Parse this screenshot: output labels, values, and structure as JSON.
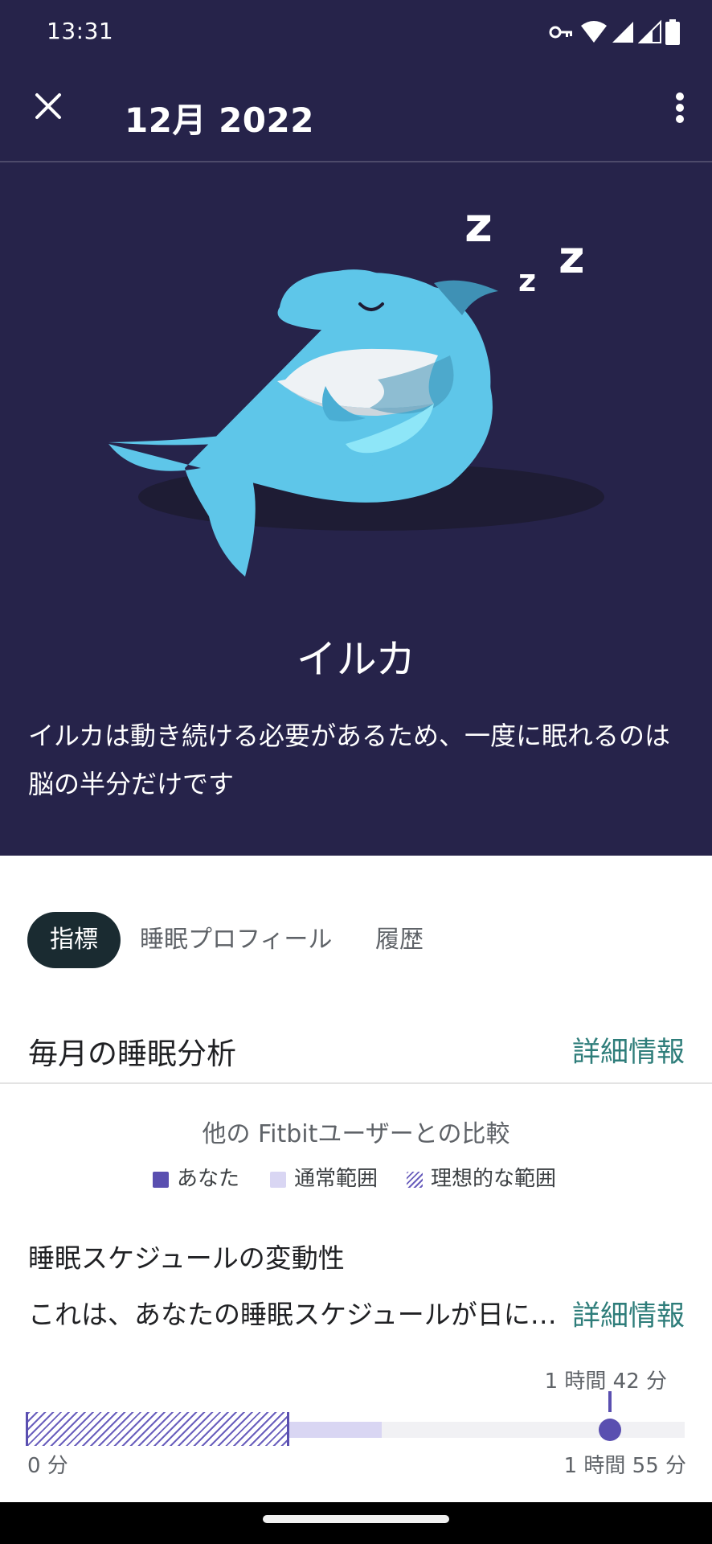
{
  "status_bar": {
    "time": "13:31"
  },
  "header": {
    "title": "12月 2022"
  },
  "hero": {
    "animal_name": "イルカ",
    "description": "イルカは動き続ける必要があるため、一度に眠れるのは脳の半分だけです"
  },
  "tabs": [
    {
      "label": "指標",
      "active": true
    },
    {
      "label": "睡眠プロフィール",
      "active": false
    },
    {
      "label": "履歴",
      "active": false
    }
  ],
  "section": {
    "title": "毎月の睡眠分析",
    "link": "詳細情報"
  },
  "comparison": {
    "title": "他の Fitbitユーザーとの比較",
    "legend": [
      {
        "label": "あなた",
        "color": "#5a4fb0"
      },
      {
        "label": "通常範囲",
        "color": "#d9d6f3"
      },
      {
        "label": "理想的な範囲",
        "color": "#6a5fbd"
      }
    ]
  },
  "metric": {
    "title": "睡眠スケジュールの変動性",
    "description": "これは、あなたの睡眠スケジュールが日に…",
    "link": "詳細情報",
    "your_value_label": "1 時間 42 分",
    "min_label": "0 分",
    "max_label": "1 時間 55 分",
    "your_value_minutes": 102,
    "max_minutes": 115,
    "ideal_range_fraction": 0.4,
    "normal_range_fraction": 0.54
  },
  "colors": {
    "background_dark": "#26234a",
    "accent_link": "#2e7d7a",
    "you": "#5a4fb0"
  }
}
